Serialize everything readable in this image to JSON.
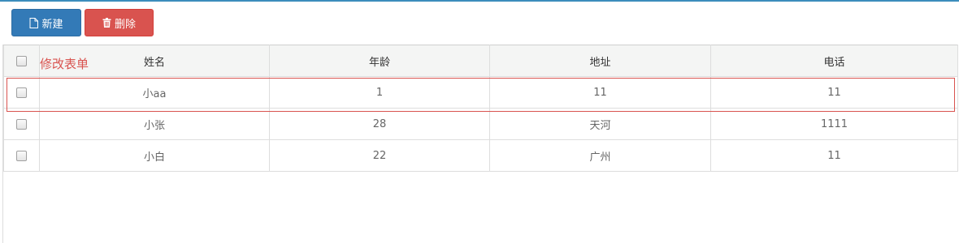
{
  "toolbar": {
    "new_label": "新建",
    "delete_label": "删除"
  },
  "table": {
    "columns": [
      "姓名",
      "年龄",
      "地址",
      "电话"
    ],
    "rows": [
      {
        "name": "小aa",
        "age": "1",
        "address": "11",
        "phone": "11"
      },
      {
        "name": "小张",
        "age": "28",
        "address": "天河",
        "phone": "1111"
      },
      {
        "name": "小白",
        "age": "22",
        "address": "广州",
        "phone": "11"
      }
    ]
  },
  "annotation": {
    "label": "修改表单",
    "color": "#d9534f"
  },
  "colors": {
    "primary": "#337ab7",
    "danger": "#d9534f",
    "accent_top_bar": "#3c8dbc"
  },
  "icons": {
    "new": "file-icon",
    "delete": "trash-icon"
  }
}
